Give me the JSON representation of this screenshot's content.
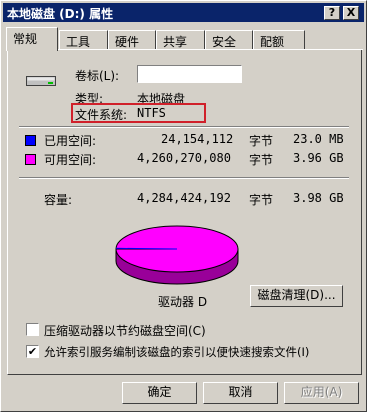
{
  "window": {
    "title": "本地磁盘 (D:) 属性",
    "help_btn": "?",
    "close_btn": "X"
  },
  "tabs": [
    {
      "label": "常规",
      "active": true
    },
    {
      "label": "工具"
    },
    {
      "label": "硬件"
    },
    {
      "label": "共享"
    },
    {
      "label": "安全"
    },
    {
      "label": "配额"
    }
  ],
  "general": {
    "volume_label_caption": "卷标(L):",
    "volume_label_value": "",
    "type_caption": "类型:",
    "type_value": "本地磁盘",
    "fs_caption": "文件系统:",
    "fs_value": "NTFS",
    "used_caption": "已用空间:",
    "used_bytes": "24,154,112",
    "used_unit": "字节",
    "used_size": "23.0 MB",
    "free_caption": "可用空间:",
    "free_bytes": "4,260,270,080",
    "free_unit": "字节",
    "free_size": "3.96 GB",
    "capacity_caption": "容量:",
    "capacity_bytes": "4,284,424,192",
    "capacity_unit": "字节",
    "capacity_size": "3.98 GB",
    "drive_caption": "驱动器 D",
    "cleanup_button": "磁盘清理(D)...",
    "compress_label": "压缩驱动器以节约磁盘空间(C)",
    "compress_checked": false,
    "index_label": "允许索引服务编制该磁盘的索引以便快速搜索文件(I)",
    "index_checked": true
  },
  "colors": {
    "used": "#0000ff",
    "free": "#ff00ff"
  },
  "buttons": {
    "ok": "确定",
    "cancel": "取消",
    "apply": "应用(A)"
  }
}
